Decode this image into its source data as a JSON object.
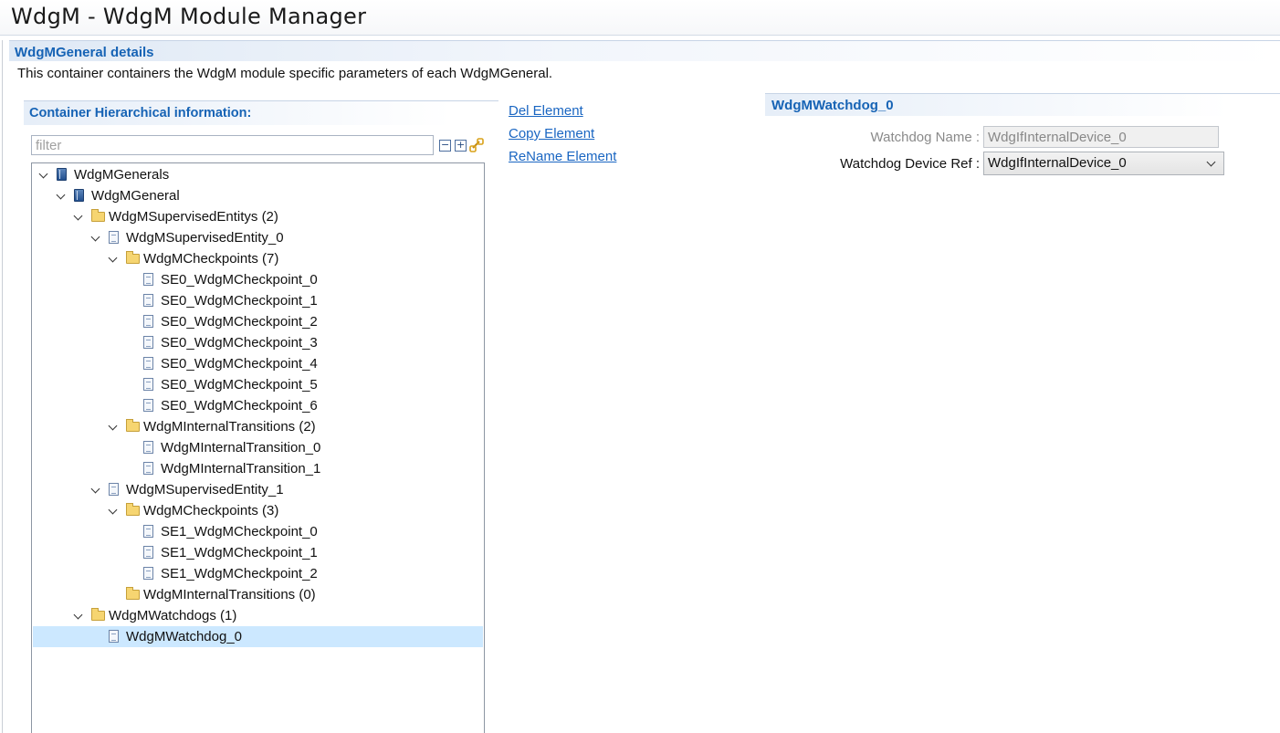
{
  "window": {
    "title": "WdgM - WdgM Module Manager"
  },
  "section": {
    "title": "WdgMGeneral details",
    "description": "This container containers the WdgM module specific parameters of each WdgMGeneral."
  },
  "left_panel": {
    "title": "Container Hierarchical information:",
    "filter_placeholder": "filter",
    "toolbar_icons": [
      "collapse-all-icon",
      "expand-all-icon",
      "link-sync-icon"
    ]
  },
  "tree": [
    {
      "label": "WdgMGenerals",
      "level": 0,
      "icon": "module-icon",
      "expanded": true
    },
    {
      "label": "WdgMGeneral",
      "level": 1,
      "icon": "module-icon",
      "expanded": true
    },
    {
      "label": "WdgMSupervisedEntitys (2)",
      "level": 2,
      "icon": "folder-icon",
      "expanded": true
    },
    {
      "label": "WdgMSupervisedEntity_0",
      "level": 3,
      "icon": "file-icon",
      "expanded": true
    },
    {
      "label": "WdgMCheckpoints (7)",
      "level": 4,
      "icon": "folder-icon",
      "expanded": true
    },
    {
      "label": "SE0_WdgMCheckpoint_0",
      "level": 5,
      "icon": "file-icon"
    },
    {
      "label": "SE0_WdgMCheckpoint_1",
      "level": 5,
      "icon": "file-icon"
    },
    {
      "label": "SE0_WdgMCheckpoint_2",
      "level": 5,
      "icon": "file-icon"
    },
    {
      "label": "SE0_WdgMCheckpoint_3",
      "level": 5,
      "icon": "file-icon"
    },
    {
      "label": "SE0_WdgMCheckpoint_4",
      "level": 5,
      "icon": "file-icon"
    },
    {
      "label": "SE0_WdgMCheckpoint_5",
      "level": 5,
      "icon": "file-icon"
    },
    {
      "label": "SE0_WdgMCheckpoint_6",
      "level": 5,
      "icon": "file-icon"
    },
    {
      "label": "WdgMInternalTransitions (2)",
      "level": 4,
      "icon": "folder-icon",
      "expanded": true
    },
    {
      "label": "WdgMInternalTransition_0",
      "level": 5,
      "icon": "file-icon"
    },
    {
      "label": "WdgMInternalTransition_1",
      "level": 5,
      "icon": "file-icon"
    },
    {
      "label": "WdgMSupervisedEntity_1",
      "level": 3,
      "icon": "file-icon",
      "expanded": true
    },
    {
      "label": "WdgMCheckpoints (3)",
      "level": 4,
      "icon": "folder-icon",
      "expanded": true
    },
    {
      "label": "SE1_WdgMCheckpoint_0",
      "level": 5,
      "icon": "file-icon"
    },
    {
      "label": "SE1_WdgMCheckpoint_1",
      "level": 5,
      "icon": "file-icon"
    },
    {
      "label": "SE1_WdgMCheckpoint_2",
      "level": 5,
      "icon": "file-icon"
    },
    {
      "label": "WdgMInternalTransitions (0)",
      "level": 4,
      "icon": "folder-icon"
    },
    {
      "label": "WdgMWatchdogs (1)",
      "level": 2,
      "icon": "folder-icon",
      "expanded": true
    },
    {
      "label": "WdgMWatchdog_0",
      "level": 3,
      "icon": "file-icon",
      "selected": true
    }
  ],
  "actions": {
    "del": "Del Element",
    "copy": "Copy Element",
    "rename": "ReName Element"
  },
  "details": {
    "title": "WdgMWatchdog_0",
    "name_label": "Watchdog Name :",
    "name_value": "WdgIfInternalDevice_0",
    "ref_label": "Watchdog Device Ref :",
    "ref_value": "WdgIfInternalDevice_0"
  },
  "colors": {
    "accent": "#1663b5",
    "link": "#1a66c2",
    "selection": "#cce8ff"
  }
}
